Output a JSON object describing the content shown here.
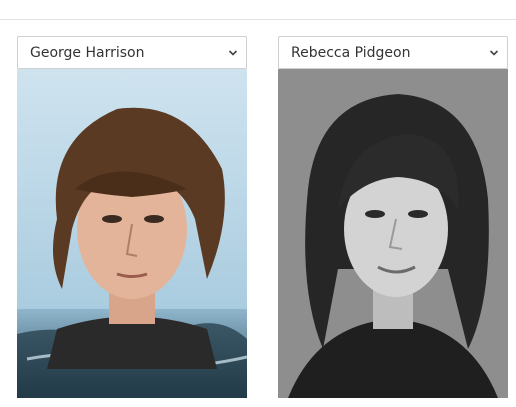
{
  "comparison": {
    "left": {
      "selected_name": "George Harrison",
      "icon": "chevron-down-icon",
      "photo": "portrait-photo"
    },
    "right": {
      "selected_name": "Rebecca Pidgeon",
      "icon": "chevron-down-icon",
      "photo": "portrait-photo"
    }
  },
  "colors": {
    "border": "#cfcfcf",
    "divider": "#e3e3e3",
    "text": "#333333"
  }
}
